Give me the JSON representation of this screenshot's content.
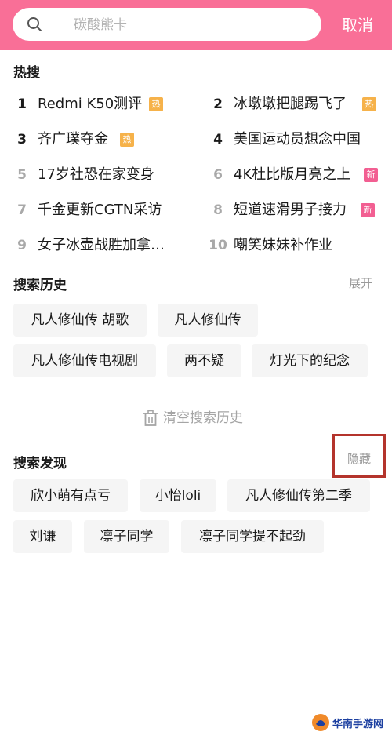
{
  "search": {
    "placeholder": "碳酸熊卡",
    "cancel_label": "取消"
  },
  "hot": {
    "title": "热搜",
    "items": [
      {
        "rank": "1",
        "text": "Redmi K50测评",
        "badge": "热"
      },
      {
        "rank": "2",
        "text": "冰墩墩把腿踢飞了",
        "badge": "热"
      },
      {
        "rank": "3",
        "text": "齐广璞夺金",
        "badge": "热"
      },
      {
        "rank": "4",
        "text": "美国运动员想念中国",
        "badge": ""
      },
      {
        "rank": "5",
        "text": "17岁社恐在家变身",
        "badge": ""
      },
      {
        "rank": "6",
        "text": "4K杜比版月亮之上",
        "badge": "新"
      },
      {
        "rank": "7",
        "text": "千金更新CGTN采访",
        "badge": ""
      },
      {
        "rank": "8",
        "text": "短道速滑男子接力",
        "badge": "新"
      },
      {
        "rank": "9",
        "text": "女子冰壶战胜加拿…",
        "badge": ""
      },
      {
        "rank": "10",
        "text": "嘲笑妹妹补作业",
        "badge": ""
      }
    ]
  },
  "history": {
    "title": "搜索历史",
    "expand_label": "展开",
    "chips": [
      "凡人修仙传 胡歌",
      "凡人修仙传",
      "凡人修仙传电视剧",
      "两不疑",
      "灯光下的纪念"
    ],
    "clear_label": "清空搜索历史"
  },
  "discover": {
    "title": "搜索发现",
    "hide_label": "隐藏",
    "chips": [
      "欣小萌有点亏",
      "小怡loli",
      "凡人修仙传第二季",
      "刘谦",
      "凛子同学",
      "凛子同学提不起劲"
    ]
  },
  "watermark": {
    "text": "华南手游网"
  },
  "colors": {
    "header": "#f96f97",
    "badge_hot": "#f6b24a",
    "badge_new": "#f25f92",
    "highlight_border": "#b4342c"
  },
  "icons": {
    "search": "search-icon",
    "trash": "trash-icon",
    "logo": "watermark-logo-icon"
  }
}
